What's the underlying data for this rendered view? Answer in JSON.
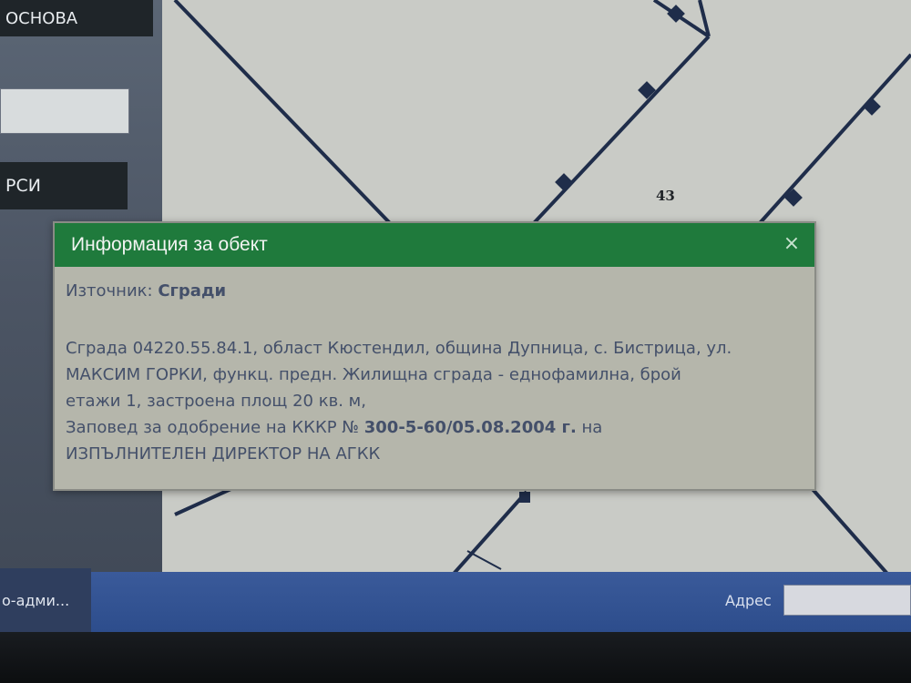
{
  "left_panel": {
    "basis_button": "ОСНОВА",
    "search_button": "РСИ",
    "search_value": ""
  },
  "map": {
    "parcel_number": "43"
  },
  "popup": {
    "title": "Информация за обект",
    "close_icon": "×",
    "source_label": "Източник:",
    "source_value": "Сгради",
    "description_1": "Сграда 04220.55.84.1, област Кюстендил, община Дупница, с. Бистрица, ул.",
    "description_2": "МАКСИМ ГОРКИ, функц. предн. Жилищна сграда - еднофамилна, брой",
    "description_3": "етажи 1, застроена площ 20 кв. м,",
    "order_prefix": "Заповед за одобрение на КККР №",
    "order_number": "300-5-60/05.08.2004 г.",
    "order_suffix": "на",
    "issuer": "ИЗПЪЛНИТЕЛЕН ДИРЕКТОР НА АГКК"
  },
  "statusbar": {
    "admin_text": "о-адми...",
    "address_label": "Адрес",
    "address_value": ""
  },
  "colors": {
    "popup_header": "#1f7a3c",
    "popup_body": "#b5b6ab",
    "statusbar": "#2d4d8c"
  }
}
